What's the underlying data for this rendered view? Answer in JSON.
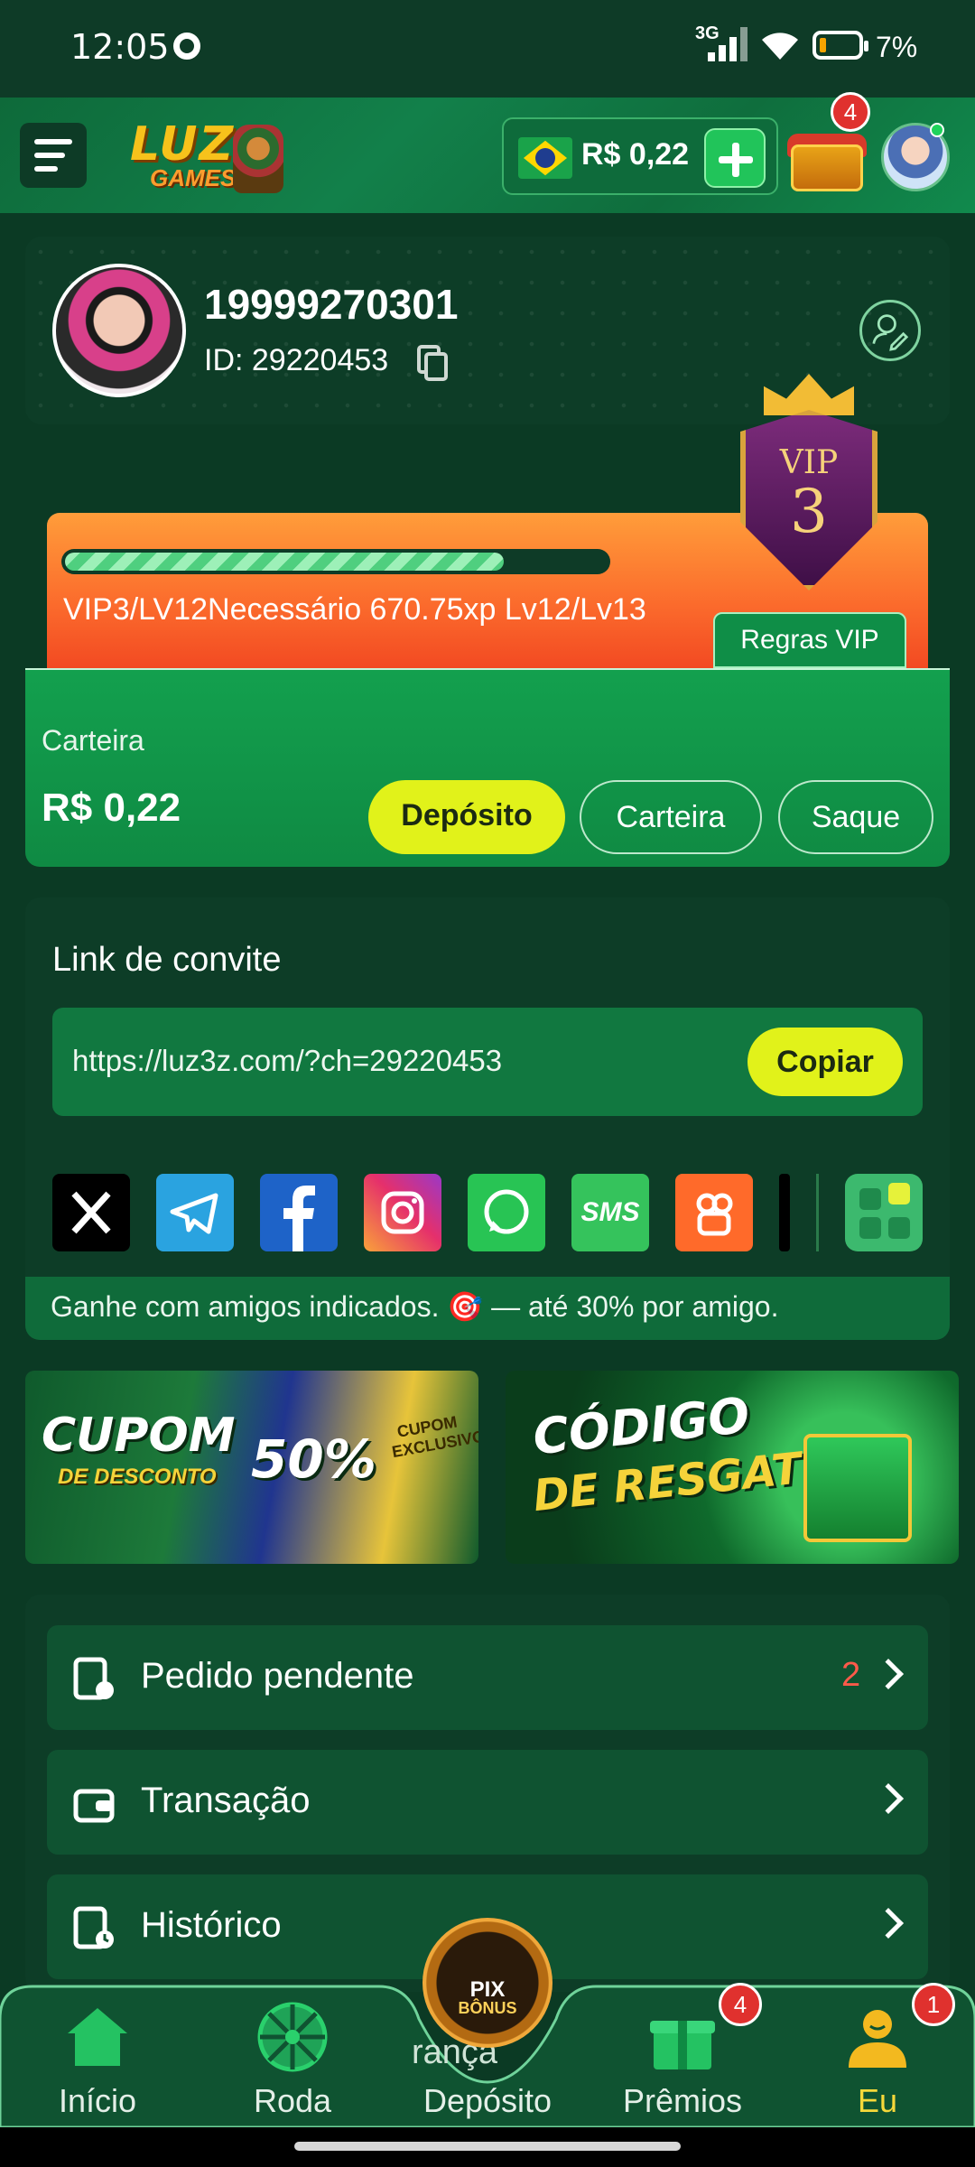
{
  "status_bar": {
    "time": "12:05",
    "network": "3G",
    "battery": "7%"
  },
  "header": {
    "logo_line1": "LUZ",
    "logo_line2": "GAMES",
    "balance": "R$ 0,22",
    "chest_badge": "4"
  },
  "profile": {
    "username": "19999270301",
    "id_label": "ID: 29220453"
  },
  "vip": {
    "progress": 0.81,
    "progress_text": "VIP3/LV12Necessário 670.75xp Lv12/Lv13",
    "rules_label": "Regras VIP",
    "badge_line1": "VIP",
    "badge_line2": "3"
  },
  "wallet": {
    "label": "Carteira",
    "amount": "R$ 0,22",
    "deposit_label": "Depósito",
    "wallet_label": "Carteira",
    "withdraw_label": "Saque"
  },
  "invite": {
    "title": "Link de convite",
    "url": "https://luz3z.com/?ch=29220453",
    "copy_label": "Copiar",
    "share_icons": [
      "x-icon",
      "telegram-icon",
      "facebook-icon",
      "instagram-icon",
      "whatsapp-icon",
      "sms-icon",
      "kwai-icon",
      "tiktok-icon",
      "more-apps-icon"
    ],
    "sms_text": "SMS",
    "note": "Ganhe com amigos indicados. 🎯 — até 30% por amigo."
  },
  "banners": {
    "coupon_line1": "CUPOM",
    "coupon_line2": "DE DESCONTO",
    "coupon_pct": "50%",
    "coupon_tag": "CUPOM EXCLUSIVO",
    "code_line1": "CÓDIGO",
    "code_line2": "DE RESGATE"
  },
  "menu": {
    "items": [
      {
        "label": "Pedido pendente",
        "count": "2",
        "icon": "pending-order-icon"
      },
      {
        "label": "Transação",
        "count": "",
        "icon": "wallet-transaction-icon"
      },
      {
        "label": "Histórico",
        "count": "",
        "icon": "history-icon"
      }
    ],
    "partial_label": "rança"
  },
  "nav": {
    "items": [
      {
        "label": "Início",
        "icon": "home-icon"
      },
      {
        "label": "Roda",
        "icon": "wheel-icon"
      },
      {
        "label": "Depósito",
        "icon": "pix-bonus-icon"
      },
      {
        "label": "Prêmios",
        "icon": "gift-icon",
        "badge": "4"
      },
      {
        "label": "Eu",
        "icon": "user-icon",
        "badge": "1"
      }
    ],
    "pix_line1": "PIX",
    "pix_line2": "BÔNUS"
  },
  "colors": {
    "accent_yellow": "#e1f21a",
    "primary_green": "#0f8a43",
    "dark_green": "#0d3d27",
    "badge_red": "#e0312e",
    "vip_orange": "#fb6a2c"
  }
}
